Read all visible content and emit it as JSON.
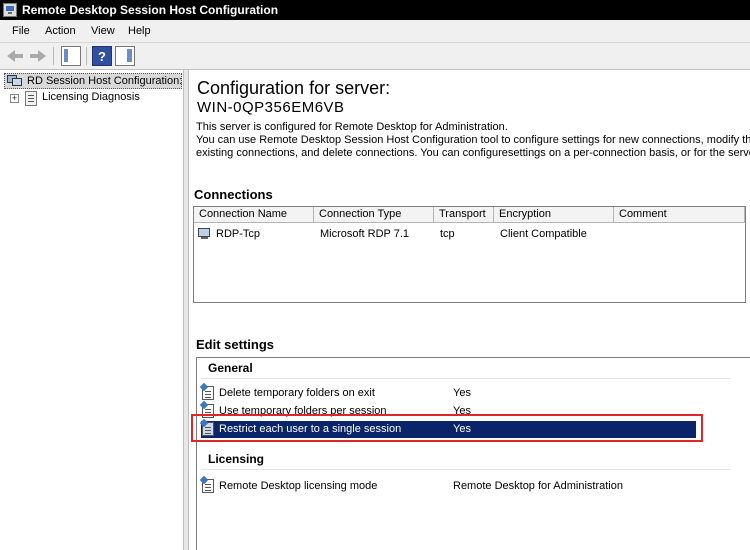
{
  "window": {
    "title": "Remote Desktop Session Host Configuration"
  },
  "menu": {
    "items": [
      "File",
      "Action",
      "View",
      "Help"
    ]
  },
  "toolbar": {
    "buttons": [
      "back-icon",
      "forward-icon",
      "show-hide-console-tree-icon",
      "help-icon",
      "show-hide-action-pane-icon"
    ]
  },
  "tree": {
    "root_label": "RD Session Host Configuration:",
    "child_label": "Licensing Diagnosis",
    "child_expander": "+"
  },
  "main": {
    "title": "Configuration for server:",
    "server_name": "WIN-0QP356EM6VB",
    "description": [
      "This server is configured for Remote Desktop for Administration.",
      "You can use Remote Desktop Session Host Configuration tool to configure settings for new connections, modify the s",
      "existing connections, and delete connections. You can configuresettings on a per-connection basis, or for the server a"
    ]
  },
  "connections": {
    "heading": "Connections",
    "columns": [
      "Connection Name",
      "Connection Type",
      "Transport",
      "Encryption",
      "Comment"
    ],
    "rows": [
      {
        "name": "RDP-Tcp",
        "type": "Microsoft RDP 7.1",
        "transport": "tcp",
        "encryption": "Client Compatible",
        "comment": ""
      }
    ]
  },
  "edit_settings": {
    "heading": "Edit settings",
    "general": {
      "heading": "General",
      "items": [
        {
          "name": "Delete temporary folders on exit",
          "value": "Yes"
        },
        {
          "name": "Use temporary folders per session",
          "value": "Yes"
        },
        {
          "name": "Restrict each user to a single session",
          "value": "Yes",
          "selected": true
        }
      ]
    },
    "licensing": {
      "heading": "Licensing",
      "items": [
        {
          "name": "Remote Desktop licensing mode",
          "value": "Remote Desktop for Administration"
        }
      ]
    }
  },
  "colors": {
    "selection": "#0a246a",
    "highlight_outline": "#e0262b",
    "titlebar": "#000000"
  }
}
